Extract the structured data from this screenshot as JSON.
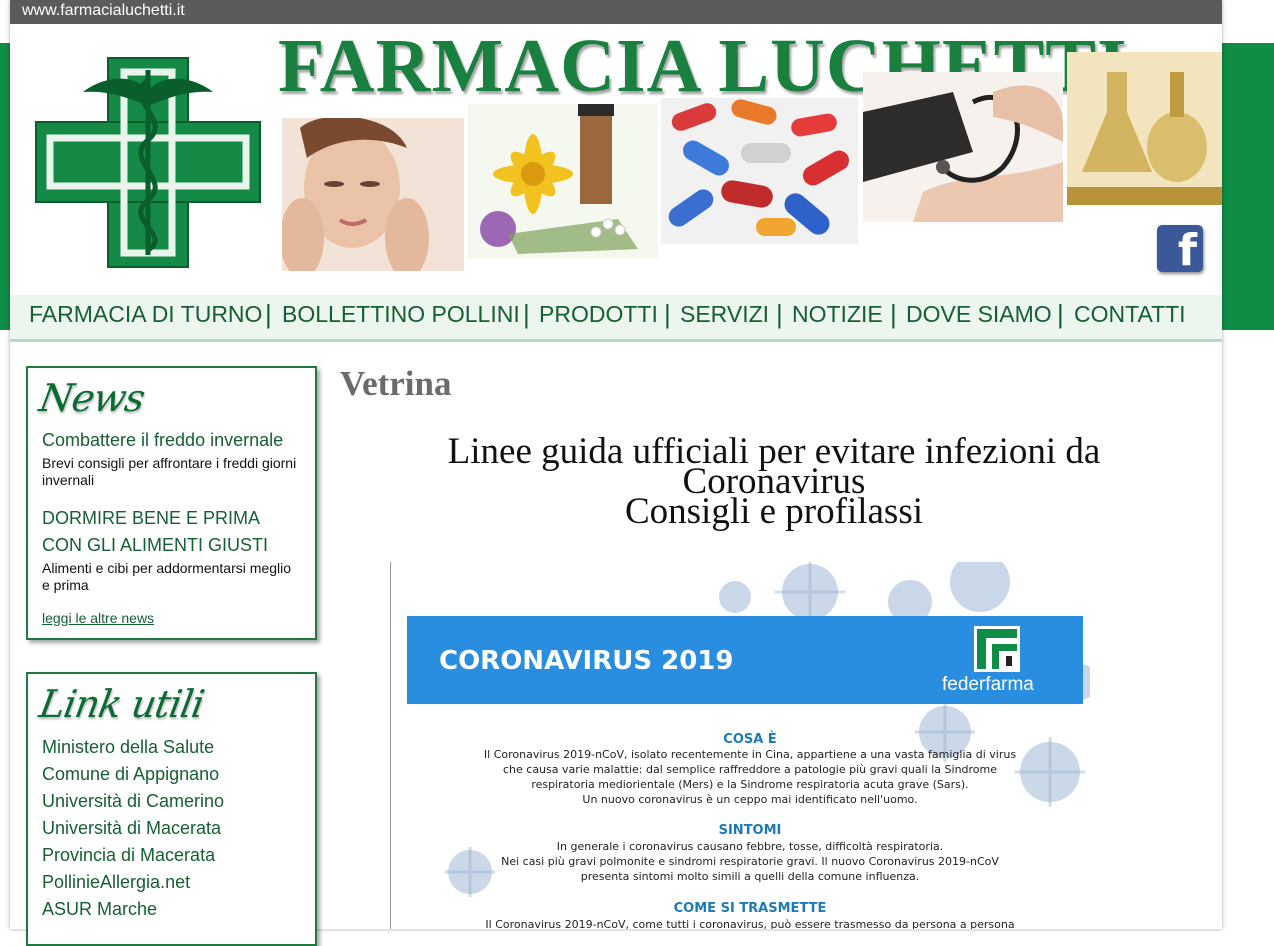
{
  "url_bar": {
    "text": "www.farmacialuchetti.it"
  },
  "header": {
    "title": "FARMACIA LUCHETTI",
    "facebook_glyph": "f",
    "icons": [
      "pharmacy-cross-logo",
      "facebook-icon"
    ]
  },
  "nav": {
    "items": [
      "FARMACIA DI TURNO",
      "BOLLETTINO POLLINI",
      "PRODOTTI",
      "SERVIZI",
      "NOTIZIE",
      "DOVE SIAMO",
      "CONTATTI"
    ],
    "separator": "|"
  },
  "news": {
    "title": "News",
    "items": [
      {
        "headline": "Combattere il freddo invernale",
        "desc": "Brevi consigli per affrontare i freddi giorni invernali"
      },
      {
        "headline_line1": "DORMIRE BENE E PRIMA",
        "headline_line2": "CON GLI ALIMENTI GIUSTI",
        "desc": "Alimenti e cibi per addormentarsi meglio e prima"
      }
    ],
    "more": "leggi le altre news"
  },
  "links": {
    "title": "Link utili",
    "items": [
      "Ministero della Salute",
      "Comune di Appignano",
      "Università di Camerino",
      "Università di Macerata",
      "Provincia di Macerata",
      "PollinieAllergia.net",
      "ASUR Marche"
    ]
  },
  "main": {
    "section_title": "Vetrina",
    "headline_line1": "Linee guida ufficiali per evitare infezioni da",
    "headline_line2": "Coronavirus",
    "headline_line3": "Consigli e profilassi"
  },
  "poster": {
    "banner_title": "CORONAVIRUS 2019",
    "brand": "federfarma",
    "sections": [
      {
        "title": "COSA È",
        "lines": [
          "Il Coronavirus 2019-nCoV, isolato recentemente in Cina, appartiene a una vasta famiglia di virus",
          "che causa varie malattie: dal semplice raffreddore a patologie più gravi quali la Sindrome",
          "respiratoria mediorientale (Mers) e la Sindrome respiratoria acuta grave (Sars).",
          "Un nuovo coronavirus è un ceppo mai identificato nell'uomo."
        ]
      },
      {
        "title": "SINTOMI",
        "lines": [
          "In generale i coronavirus causano febbre, tosse, difficoltà respiratoria.",
          "Nei casi più gravi polmonite e sindromi respiratorie gravi. Il nuovo Coronavirus 2019-nCoV",
          "presenta sintomi molto simili a quelli della comune influenza."
        ]
      },
      {
        "title": "COME SI TRASMETTE",
        "lines": [
          "Il Coronavirus 2019-nCoV, come tutti i coronavirus, può essere trasmesso da persona a persona"
        ]
      }
    ]
  },
  "colors": {
    "brand_green": "#0f8c45",
    "nav_text": "#155f33",
    "banner_blue": "#2a8ee0",
    "facebook": "#3b5998"
  }
}
